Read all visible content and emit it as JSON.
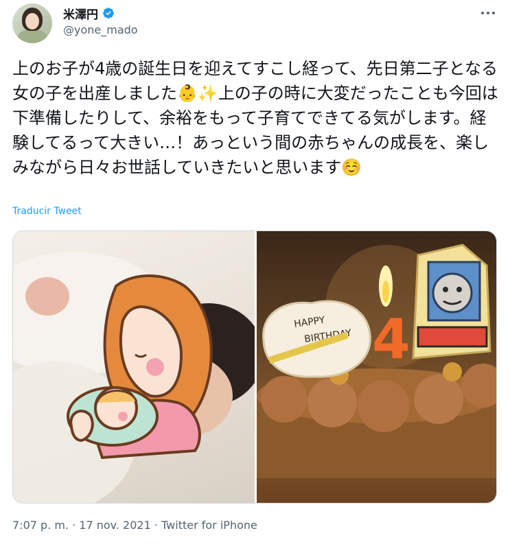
{
  "author": {
    "display_name": "米澤円",
    "handle": "@yone_mado",
    "verified": true
  },
  "tweet": {
    "text": "上のお子が4歳の誕生日を迎えてすこし経って、先日第二子となる女の子を出産しました👶✨上の子の時に大変だったことも今回は下準備したりして、余裕をもって子育てできてる気がします。経験してるって大きい…！あっという間の赤ちゃんの成長を、楽しみながら日々お世話していきたいと思います☺️",
    "translate_label": "Traducir Tweet"
  },
  "media": {
    "cake_topper_text": "HAPPY BIRTHDAY",
    "candle_number": "4"
  },
  "meta": {
    "time": "7:07 p. m.",
    "separator": " · ",
    "date": "17 nov. 2021",
    "source": "Twitter for iPhone"
  },
  "colors": {
    "verified": "#1d9bf0",
    "link": "#1d9bf0",
    "secondary_text": "#536471"
  }
}
